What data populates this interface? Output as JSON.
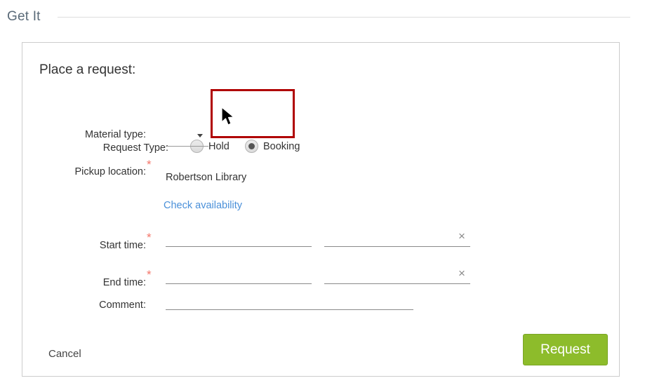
{
  "header": {
    "title": "Get It"
  },
  "card": {
    "title": "Place a request:",
    "fields": {
      "request_type": {
        "label": "Request Type:",
        "options": [
          {
            "label": "Hold",
            "selected": false
          },
          {
            "label": "Booking",
            "selected": true
          }
        ]
      },
      "material_type": {
        "label": "Material type:",
        "value": "",
        "caret": "chevron-down-icon"
      },
      "pickup_location": {
        "label": "Pickup location:",
        "required_marker": "*",
        "value": "Robertson Library",
        "availability_link": "Check availability"
      },
      "start_time": {
        "label": "Start time:",
        "required_marker": "*",
        "date_value": "",
        "time_value": "",
        "clear_icon": "×"
      },
      "end_time": {
        "label": "End time:",
        "required_marker": "*",
        "date_value": "",
        "time_value": "",
        "clear_icon": "×"
      },
      "comment": {
        "label": "Comment:",
        "value": ""
      }
    },
    "actions": {
      "cancel_label": "Cancel",
      "submit_label": "Request"
    }
  },
  "colors": {
    "accent_green": "#8dbc2b",
    "link_blue": "#4a90d9",
    "required_star": "#f4766a",
    "highlight_red": "#b00000",
    "header_text": "#5a6a78"
  }
}
